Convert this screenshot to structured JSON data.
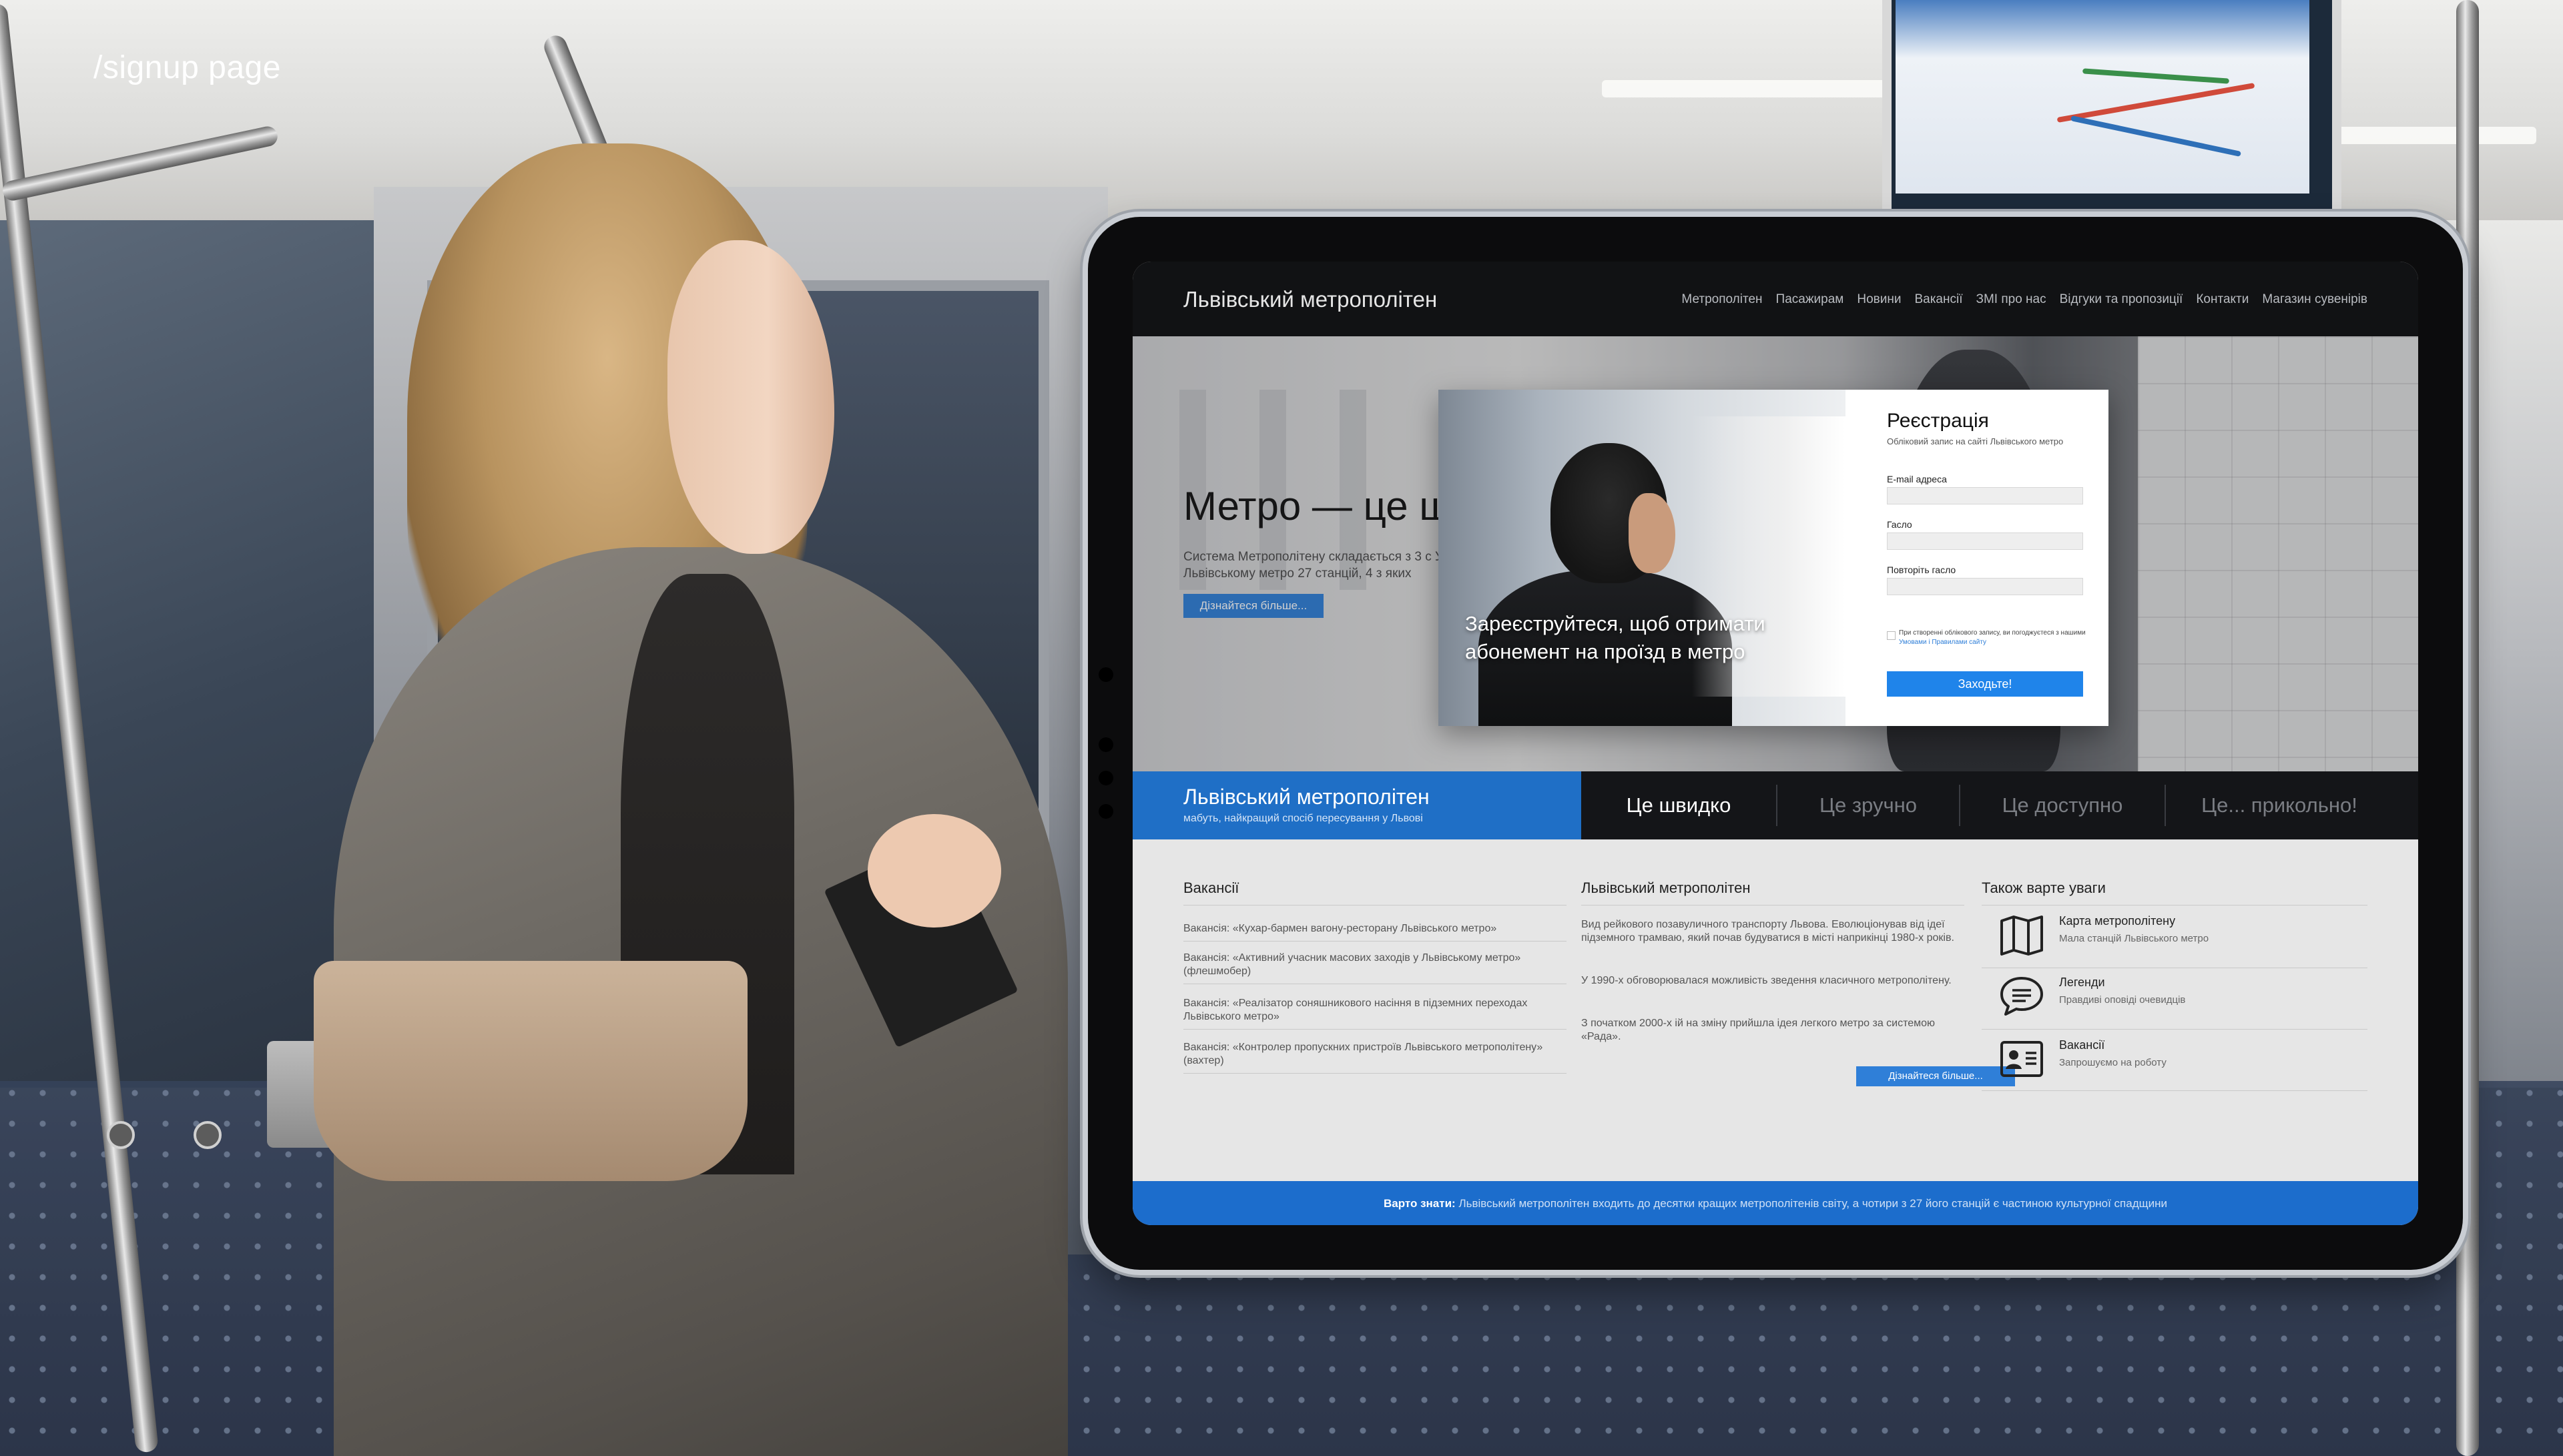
{
  "overlay_label": "/signup page",
  "site": {
    "logo": "Львівський метрополітен",
    "nav": [
      "Метрополітен",
      "Пасажирам",
      "Новини",
      "Вакансії",
      "ЗМІ про нас",
      "Відгуки та пропозиції",
      "Контакти",
      "Магазин сувенірів"
    ]
  },
  "hero": {
    "title": "Метро — це ш",
    "text": "Система Метрополітену складається з 3 с У Львівському метро 27 станцій, 4 з яких",
    "button": "Дізнайтеся більше..."
  },
  "modal": {
    "tagline": "Зареєструйтеся, щоб отримати абонемент на проїзд в метро",
    "title": "Реєстрація",
    "subtitle": "Обліковий запис на сайті Львівського метро",
    "fields": {
      "email_label": "E-mail адреса",
      "password_label": "Гасло",
      "repeat_label": "Повторіть гасло"
    },
    "consent_text": "При створенні облікового запису, ви погоджуєтеся з нашими",
    "consent_link": "Умовами і Правилами сайту",
    "submit": "Заходьте!"
  },
  "band": {
    "title": "Львівський метрополітен",
    "subtitle": "мабуть, найкращий спосіб пересування у Львові",
    "tabs": [
      "Це швидко",
      "Це зручно",
      "Це доступно",
      "Це... прикольно!"
    ]
  },
  "content": {
    "vacancies": {
      "title": "Вакансії",
      "items": [
        "Вакансія: «Кухар-бармен вагону-ресторану Львівського метро»",
        "Вакансія: «Активний учасник масових заходів у Львівському метро» (флешмобер)",
        "Вакансія: «Реалізатор соняшникового насіння в підземних переходах Львівського метро»",
        "Вакансія: «Контролер пропускних пристроїв Львівського метрополітену» (вахтер)"
      ]
    },
    "about": {
      "title": "Львівський метрополітен",
      "paragraphs": [
        "Вид рейкового позавуличного транспорту Львова. Еволюціонував від ідеї підземного трамваю, який почав будуватися в місті наприкінці 1980-х років.",
        "У 1990-х обговорювалася можливість зведення класичного метрополітену.",
        "З початком 2000-х ій на зміну прийшла ідея легкого метро за системою «Рада»."
      ],
      "more": "Дізнайтеся більше..."
    },
    "aside": {
      "title": "Також варте уваги",
      "items": [
        {
          "icon": "map-icon",
          "name": "Карта метрополітену",
          "desc": "Мала станцій Львівського метро"
        },
        {
          "icon": "speech-bubble-icon",
          "name": "Легенди",
          "desc": "Правдиві оповіді очевидців"
        },
        {
          "icon": "id-card-icon",
          "name": "Вакансії",
          "desc": "Запрошуємо на роботу"
        }
      ]
    }
  },
  "footer": {
    "lead": "Варто знати:",
    "text": "Львівський метрополітен входить до десятки кращих метрополітенів світу, а чотири з 27 його станцій є частиною культурної спадщини"
  },
  "colors": {
    "accent_blue": "#1f84ea",
    "band_blue": "#1f6fc6",
    "header_dark": "#111214",
    "footer_blue": "#1c6dcc"
  }
}
